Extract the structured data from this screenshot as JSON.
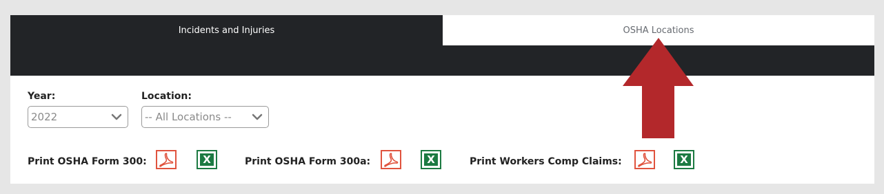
{
  "tabs": [
    {
      "label": "Incidents and Injuries",
      "active": true
    },
    {
      "label": "OSHA Locations",
      "active": false
    }
  ],
  "filters": {
    "year_label": "Year:",
    "year_value": "2022",
    "location_label": "Location:",
    "location_value": "-- All Locations --"
  },
  "prints": [
    {
      "label": "Print OSHA Form 300:"
    },
    {
      "label": "Print OSHA Form 300a:"
    },
    {
      "label": "Print Workers Comp Claims:"
    }
  ],
  "icons": {
    "pdf": "pdf-icon",
    "excel": "excel-icon",
    "excel_glyph": "X",
    "chevron": "chevron-down-icon",
    "annotation": "arrow-up-icon"
  },
  "colors": {
    "tab_bar": "#222427",
    "pdf_red": "#e0533e",
    "excel_green": "#1c7a42",
    "annotation_arrow": "#b3282b"
  }
}
